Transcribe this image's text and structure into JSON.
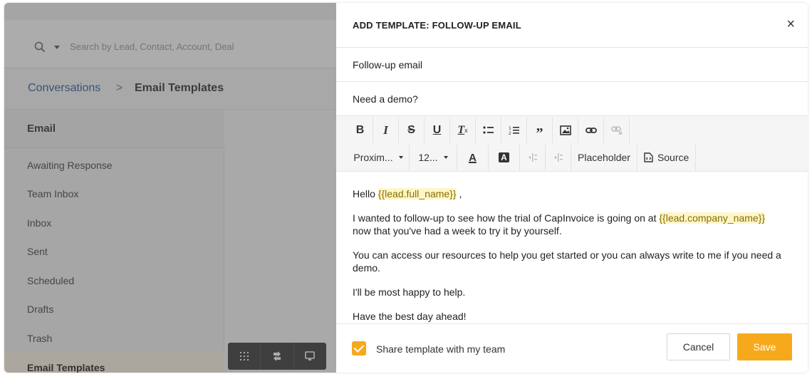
{
  "colors": {
    "accent": "#f7a91c",
    "link": "#2c5f9e",
    "placeholder_bg": "#fdf6c9"
  },
  "search": {
    "placeholder": "Search by Lead, Contact, Account, Deal"
  },
  "breadcrumb": {
    "parent": "Conversations",
    "separator": ">",
    "current": "Email Templates"
  },
  "sidebar": {
    "heading": "Email",
    "items": [
      {
        "label": "Awaiting Response"
      },
      {
        "label": "Team Inbox"
      },
      {
        "label": "Inbox"
      },
      {
        "label": "Sent"
      },
      {
        "label": "Scheduled"
      },
      {
        "label": "Drafts"
      },
      {
        "label": "Trash"
      },
      {
        "label": "Email Templates",
        "active": true
      }
    ]
  },
  "dock": {
    "icons": [
      "grid-icon",
      "swap-icon",
      "screen-icon"
    ]
  },
  "modal": {
    "title": "ADD TEMPLATE: FOLLOW-UP EMAIL",
    "close": "×",
    "name_value": "Follow-up email",
    "subject_value": "Need a demo?",
    "toolbar": {
      "row1": [
        "bold-icon",
        "italic-icon",
        "strikethrough-icon",
        "underline-icon",
        "clear-format-icon",
        "bulleted-list-icon",
        "numbered-list-icon",
        "quote-icon",
        "image-icon",
        "link-icon",
        "unlink-icon"
      ],
      "font_family": "Proxim...",
      "font_size": "12...",
      "text_color_label": "A",
      "bg_color_label": "A",
      "placeholder_label": "Placeholder",
      "source_label": "Source"
    },
    "body": {
      "p1_prefix": "Hello ",
      "p1_placeholder": "{{lead.full_name}}",
      "p1_suffix": " ,",
      "p2_prefix": "I wanted to follow-up to see how the trial of CapInvoice is going on at ",
      "p2_placeholder": "{{lead.company_name}}",
      "p2_suffix": " now that you've had a week to try it by yourself.",
      "p3": "You can access our resources to help you get started or you can always write to me if you need a demo.",
      "p4": "I'll be most happy to help.",
      "p5": "Have the best day ahead!"
    },
    "footer": {
      "share_checked": true,
      "share_label": "Share template with my team",
      "cancel_label": "Cancel",
      "save_label": "Save"
    }
  }
}
